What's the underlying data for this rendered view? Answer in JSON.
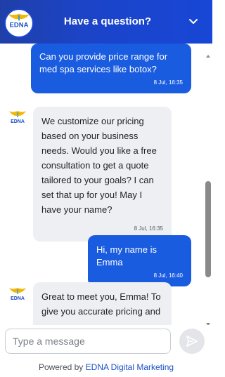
{
  "header": {
    "title": "Have a question?",
    "logo_text": "EDNA"
  },
  "messages": [
    {
      "from": "user",
      "text": "Can  you provide price range for med spa services like botox?",
      "time": "8 Jul, 16:35"
    },
    {
      "from": "bot",
      "text": "We customize our pricing based on your business needs. Would you like a free consultation to get a quote tailored to your goals? I can set that up for you! May I have your name?",
      "time": "8 Jul, 16:35"
    },
    {
      "from": "user",
      "text": "Hi, my name is Emma",
      "time": "8 Jul, 16:40"
    },
    {
      "from": "bot",
      "text": "Great to meet you, Emma! To give you accurate pricing and",
      "time": ""
    }
  ],
  "composer": {
    "placeholder": "Type a message"
  },
  "footer": {
    "powered_prefix": "Powered by",
    "brand": "EDNA Digital Marketing"
  },
  "colors": {
    "header": "#1b44c8",
    "user_bubble": "#1a5ce0",
    "bot_bubble": "#eeeff3",
    "brand_link": "#1b50c8"
  },
  "icons": {
    "collapse": "chevron-down-icon",
    "send": "send-icon",
    "logo": "edna-logo-icon"
  }
}
